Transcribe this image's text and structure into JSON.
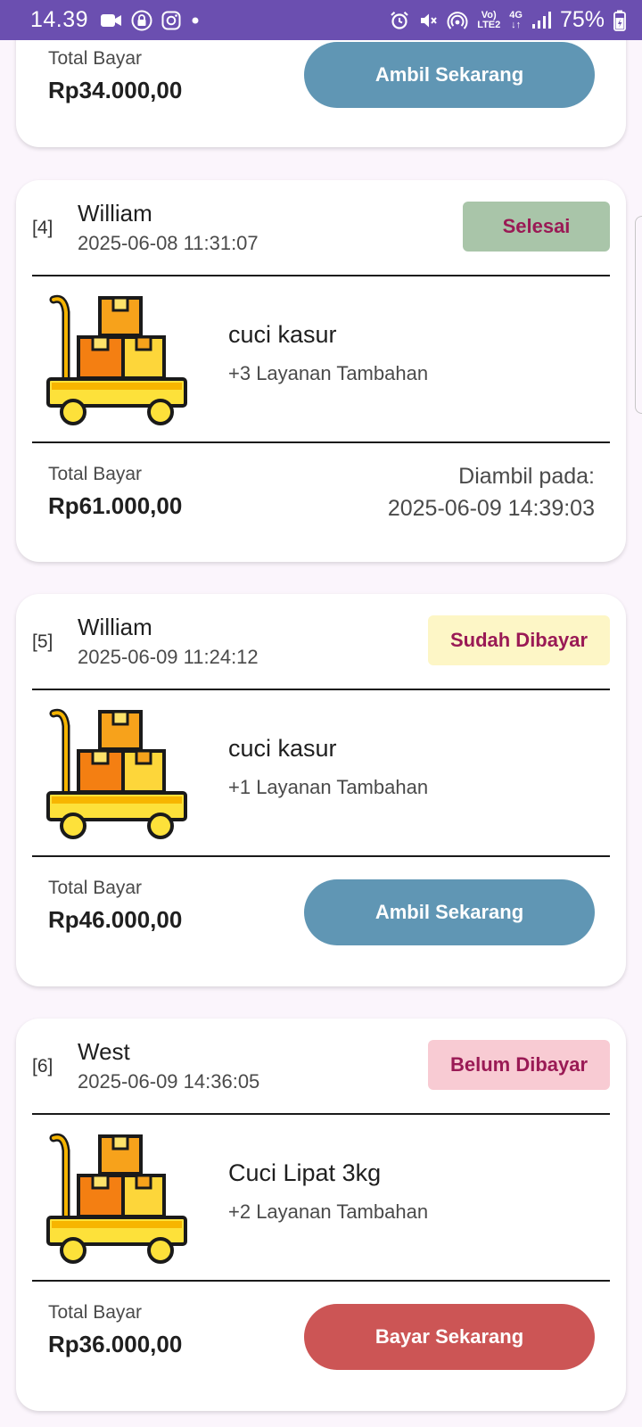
{
  "status_bar": {
    "time": "14.39",
    "battery": "75%",
    "network_top": "Vo)",
    "network_bottom": "LTE2",
    "signal_label": "4G",
    "left_icons": [
      "video-camera-icon",
      "lock-icon",
      "instagram-icon",
      "dot-icon"
    ],
    "right_icons": [
      "alarm-icon",
      "mute-icon",
      "hotspot-icon",
      "volte-icon",
      "4g-icon",
      "signal-icon",
      "battery-icon"
    ]
  },
  "orders": [
    {
      "partial": true,
      "total_label": "Total Bayar",
      "total": "Rp34.000,00",
      "action_label": "Ambil Sekarang",
      "action_color": "#6096b4"
    },
    {
      "number": "[4]",
      "customer": "William",
      "date": "2025-06-08 11:31:07",
      "status": "Selesai",
      "status_bg": "#a9c5a9",
      "service": "cuci kasur",
      "addons": "+3 Layanan Tambahan",
      "total_label": "Total Bayar",
      "total": "Rp61.000,00",
      "pickup_label": "Diambil pada:",
      "pickup_time": "2025-06-09 14:39:03"
    },
    {
      "number": "[5]",
      "customer": "William",
      "date": "2025-06-09 11:24:12",
      "status": "Sudah Dibayar",
      "status_bg": "#fdf6c6",
      "service": "cuci kasur",
      "addons": "+1 Layanan Tambahan",
      "total_label": "Total Bayar",
      "total": "Rp46.000,00",
      "action_label": "Ambil Sekarang",
      "action_color": "#6096b4"
    },
    {
      "number": "[6]",
      "customer": "West",
      "date": "2025-06-09 14:36:05",
      "status": "Belum Dibayar",
      "status_bg": "#f8cbd3",
      "service": "Cuci Lipat 3kg",
      "addons": "+2 Layanan Tambahan",
      "total_label": "Total Bayar",
      "total": "Rp36.000,00",
      "action_label": "Bayar Sekarang",
      "action_color": "#cc5555"
    }
  ],
  "colors": {
    "status_bar": "#6b4fb0",
    "background": "#fbf5fc",
    "badge_text": "#9a1a55"
  },
  "order_icon": "laundry-cart-icon"
}
